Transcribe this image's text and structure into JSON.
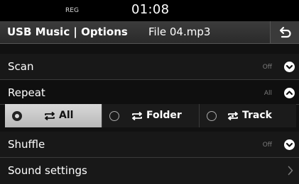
{
  "status": {
    "reg": "REG",
    "time": "01:08"
  },
  "titlebar": {
    "title": "USB Music | Options",
    "subtitle": "File 04.mp3"
  },
  "rows": {
    "scan": {
      "label": "Scan",
      "value": "Off"
    },
    "repeat": {
      "label": "Repeat",
      "value": "All"
    },
    "shuffle": {
      "label": "Shuffle",
      "value": "Off"
    },
    "sound": {
      "label": "Sound settings"
    }
  },
  "repeat_options": [
    {
      "label": "All",
      "selected": true
    },
    {
      "label": "Folder",
      "selected": false
    },
    {
      "label": "Track",
      "selected": false
    }
  ],
  "icons": {
    "back": "back-arrow-icon",
    "expand": "chevron-down-icon",
    "collapse": "chevron-up-icon",
    "next": "chevron-right-icon",
    "repeat": "repeat-icon",
    "repeat_one": "repeat-one-icon"
  },
  "colors": {
    "accent": "#ffffff",
    "muted": "#7b7b7b",
    "selected_bg": "#c8c8c8"
  }
}
